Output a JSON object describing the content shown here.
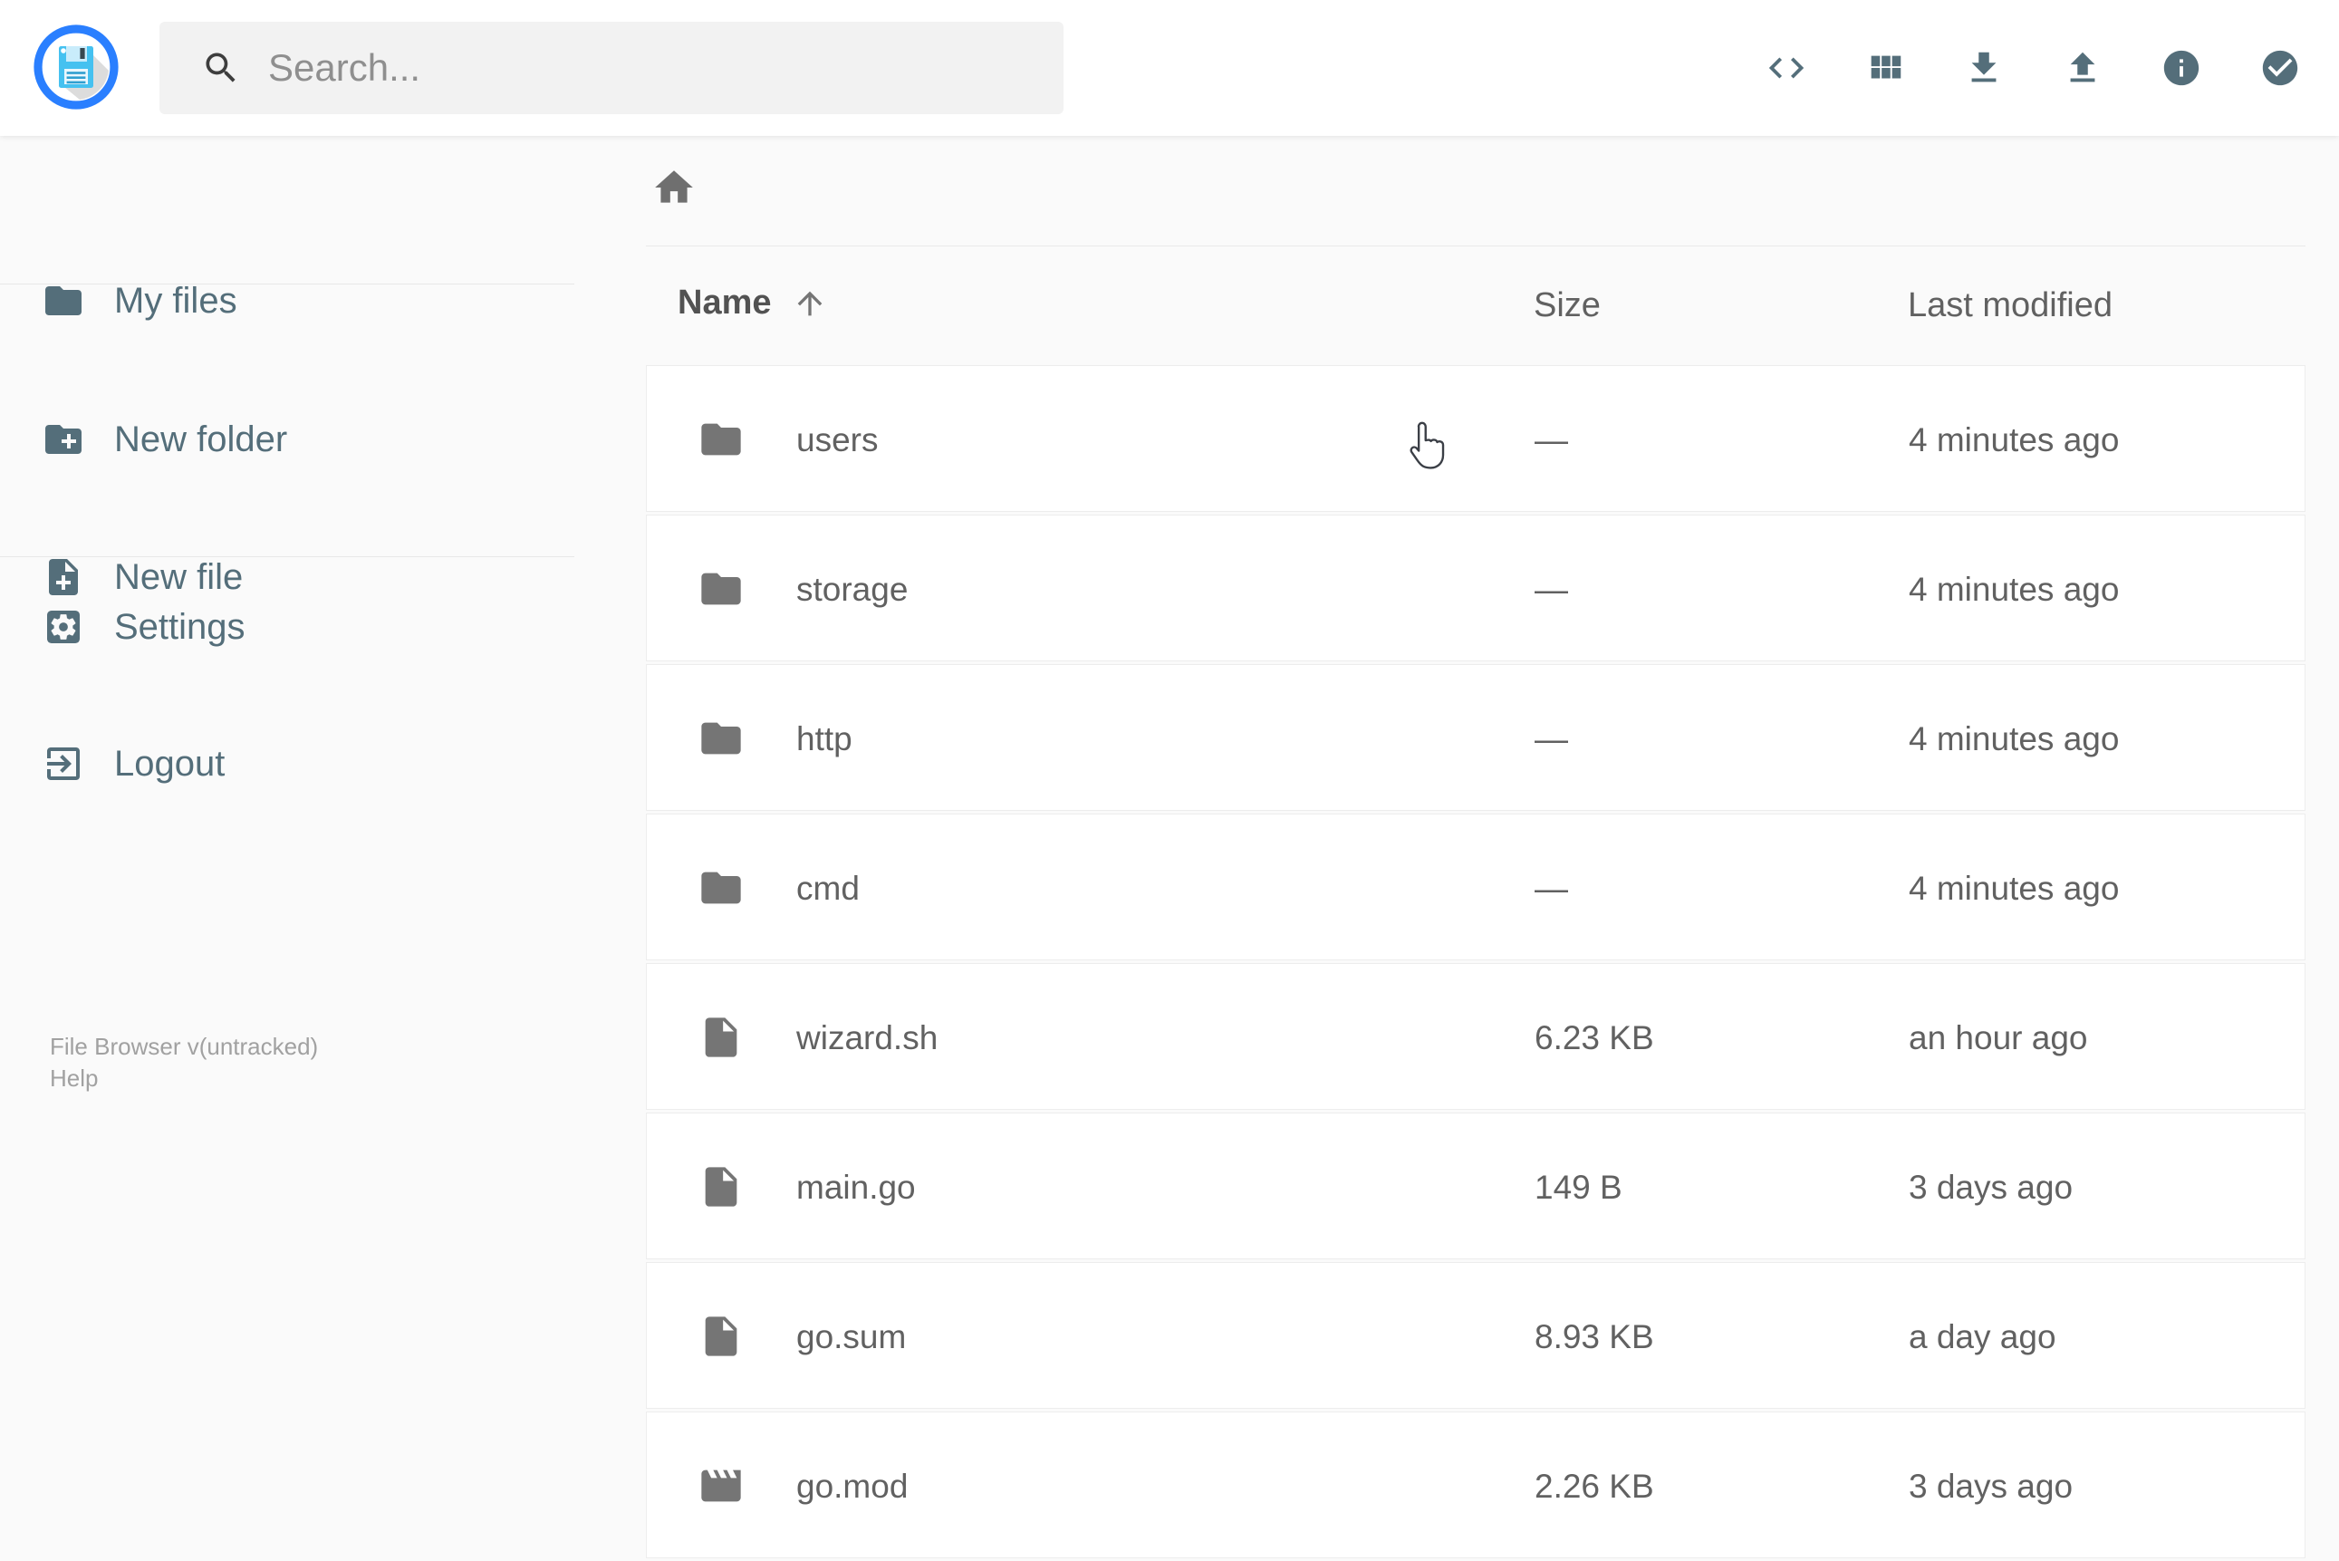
{
  "topbar": {
    "search_placeholder": "Search...",
    "action_icons": [
      "code-icon",
      "grid-view-icon",
      "download-icon",
      "upload-icon",
      "info-icon",
      "select-multiple-icon"
    ]
  },
  "sidebar": {
    "items": [
      {
        "label": "My files",
        "icon": "folder-icon"
      },
      {
        "label": "New folder",
        "icon": "create-new-folder-icon"
      },
      {
        "label": "New file",
        "icon": "note-add-icon"
      },
      {
        "label": "Settings",
        "icon": "settings-icon"
      },
      {
        "label": "Logout",
        "icon": "logout-icon"
      }
    ],
    "footer": {
      "version": "File Browser v(untracked)",
      "help": "Help"
    }
  },
  "listing": {
    "breadcrumb": {
      "icon": "home-icon"
    },
    "columns": {
      "name": "Name",
      "size": "Size",
      "modified": "Last modified"
    },
    "sort": {
      "column": "Name",
      "direction": "ascending"
    },
    "rows": [
      {
        "name": "users",
        "size": "—",
        "modified": "4 minutes ago",
        "type": "folder"
      },
      {
        "name": "storage",
        "size": "—",
        "modified": "4 minutes ago",
        "type": "folder"
      },
      {
        "name": "http",
        "size": "—",
        "modified": "4 minutes ago",
        "type": "folder"
      },
      {
        "name": "cmd",
        "size": "—",
        "modified": "4 minutes ago",
        "type": "folder"
      },
      {
        "name": "wizard.sh",
        "size": "6.23 KB",
        "modified": "an hour ago",
        "type": "file"
      },
      {
        "name": "main.go",
        "size": "149 B",
        "modified": "3 days ago",
        "type": "file"
      },
      {
        "name": "go.sum",
        "size": "8.93 KB",
        "modified": "a day ago",
        "type": "file"
      },
      {
        "name": "go.mod",
        "size": "2.26 KB",
        "modified": "3 days ago",
        "type": "movie-file"
      }
    ]
  },
  "colors": {
    "accent": "#2979ff",
    "topbar_icon": "#546e7a",
    "sidebar_text": "#546e7a",
    "row_text": "#616161",
    "row_icon": "#757575",
    "background": "#fafafa"
  }
}
